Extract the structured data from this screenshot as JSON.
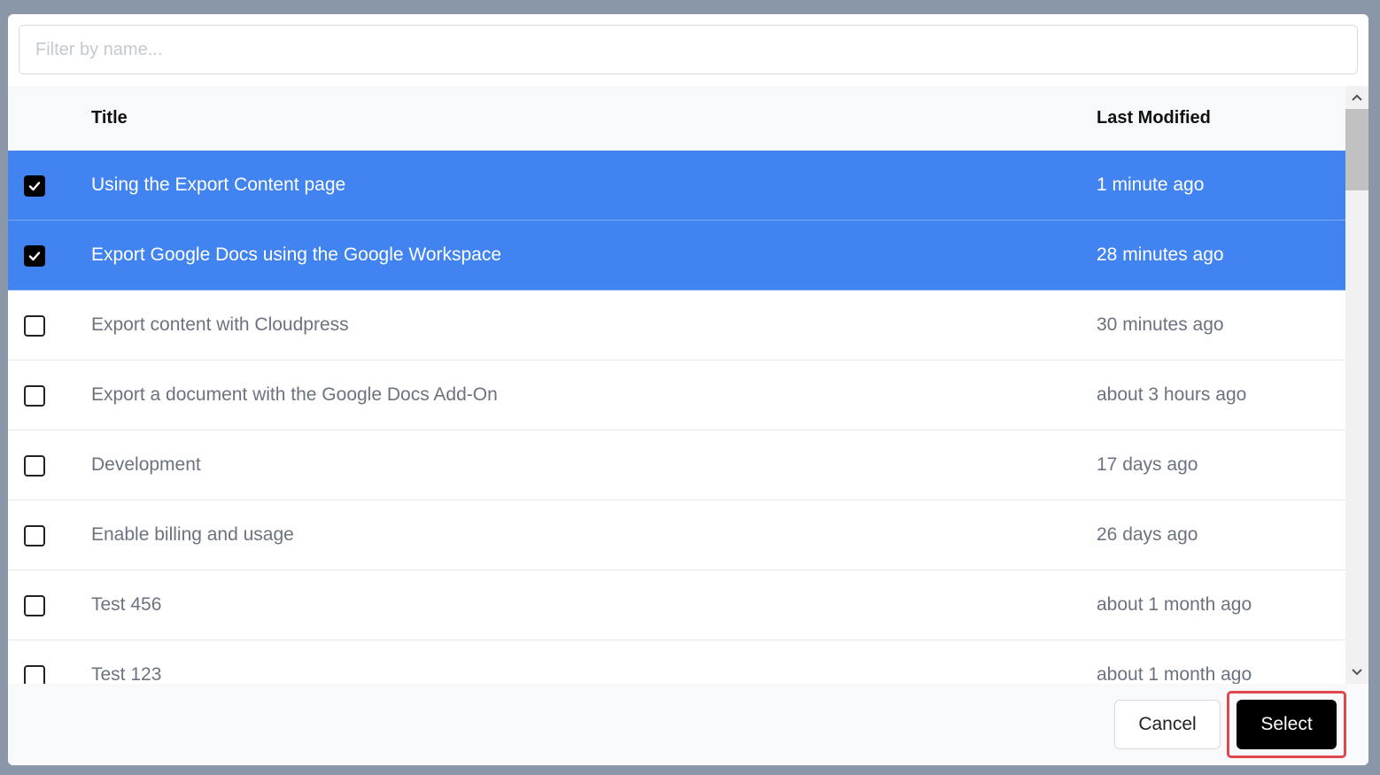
{
  "filter": {
    "placeholder": "Filter by name..."
  },
  "table": {
    "columns": {
      "title": "Title",
      "last_modified": "Last Modified"
    },
    "rows": [
      {
        "title": "Using the Export Content page",
        "modified": "1 minute ago",
        "checked": true
      },
      {
        "title": "Export Google Docs using the Google Workspace",
        "modified": "28 minutes ago",
        "checked": true
      },
      {
        "title": "Export content with Cloudpress",
        "modified": "30 minutes ago",
        "checked": false
      },
      {
        "title": "Export a document with the Google Docs Add-On",
        "modified": "about 3 hours ago",
        "checked": false
      },
      {
        "title": "Development",
        "modified": "17 days ago",
        "checked": false
      },
      {
        "title": "Enable billing and usage",
        "modified": "26 days ago",
        "checked": false
      },
      {
        "title": "Test 456",
        "modified": "about 1 month ago",
        "checked": false
      },
      {
        "title": "Test 123",
        "modified": "about 1 month ago",
        "checked": false
      }
    ]
  },
  "footer": {
    "cancel_label": "Cancel",
    "select_label": "Select"
  },
  "colors": {
    "selected_row": "#4183f0",
    "highlight": "#e0474c"
  },
  "icons": {
    "checkbox_check": "check-icon",
    "scroll_up": "chevron-up-icon",
    "scroll_down": "chevron-down-icon"
  }
}
